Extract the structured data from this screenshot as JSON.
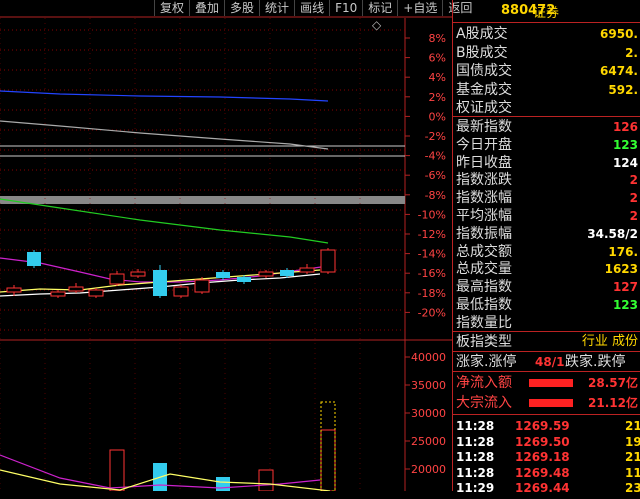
{
  "toolbar": {
    "items": [
      "复权",
      "叠加",
      "多股",
      "统计",
      "画线",
      "F10",
      "标记",
      "+自选",
      "返回"
    ]
  },
  "close_glyph": "◇",
  "price_axis": {
    "labels": [
      "8%",
      "6%",
      "4%",
      "2%",
      "0%",
      "-2%",
      "-4%",
      "-6%",
      "-8%",
      "-10%",
      "-12%",
      "-14%",
      "-16%",
      "-18%",
      "-20%"
    ]
  },
  "volume_axis": {
    "labels": [
      "40000",
      "35000",
      "30000",
      "25000",
      "20000"
    ]
  },
  "header": {
    "code": "880472",
    "name": "证券"
  },
  "trade_rows": [
    {
      "label": "A股成交",
      "value": "6950.",
      "color": "#ffd700"
    },
    {
      "label": "B股成交",
      "value": "2.",
      "color": "#ffd700"
    },
    {
      "label": "国债成交",
      "value": "6474.",
      "color": "#ffd700"
    },
    {
      "label": "基金成交",
      "value": "592.",
      "color": "#ffd700"
    },
    {
      "label": "权证成交",
      "value": "",
      "color": "#ffd700"
    }
  ],
  "index_rows": [
    {
      "label": "最新指数",
      "value": "126",
      "color": "#ff3333"
    },
    {
      "label": "今日开盘",
      "value": "123",
      "color": "#33ff33"
    },
    {
      "label": "昨日收盘",
      "value": "124",
      "color": "#ffffff"
    },
    {
      "label": "指数涨跌",
      "value": "2",
      "color": "#ff3333"
    },
    {
      "label": "指数涨幅",
      "value": "2",
      "color": "#ff3333"
    },
    {
      "label": "平均涨幅",
      "value": "2",
      "color": "#ff3333"
    },
    {
      "label": "指数振幅",
      "value": "34.58/2",
      "color": "#ffffff"
    },
    {
      "label": "总成交额",
      "value": "176.",
      "color": "#ffd700"
    },
    {
      "label": "总成交量",
      "value": "1623",
      "color": "#ffd700"
    },
    {
      "label": "最高指数",
      "value": "127",
      "color": "#ff3333"
    },
    {
      "label": "最低指数",
      "value": "123",
      "color": "#33ff33"
    },
    {
      "label": "指数量比",
      "value": "",
      "color": "#ffffff"
    }
  ],
  "sector": {
    "label": "板指类型",
    "value": "行业 成份"
  },
  "breadth": {
    "up_label": "涨家.涨停",
    "up_value": "48/1",
    "down_label": "跌家.跌停"
  },
  "flows": [
    {
      "label": "净流入额",
      "value": "28.57亿"
    },
    {
      "label": "大宗流入",
      "value": "21.12亿"
    }
  ],
  "ticks": [
    {
      "time": "11:28",
      "price": "1269.59",
      "vol": "21"
    },
    {
      "time": "11:28",
      "price": "1269.50",
      "vol": "19"
    },
    {
      "time": "11:28",
      "price": "1269.18",
      "vol": "21"
    },
    {
      "time": "11:28",
      "price": "1269.48",
      "vol": "11"
    },
    {
      "time": "11:29",
      "price": "1269.44",
      "vol": "23"
    }
  ],
  "colors": {
    "up": "#ff3333",
    "down": "#33ff33",
    "flat": "#ffffff",
    "highlight": "#ffd700",
    "grid": "#8b0000",
    "border": "#b22222"
  }
}
